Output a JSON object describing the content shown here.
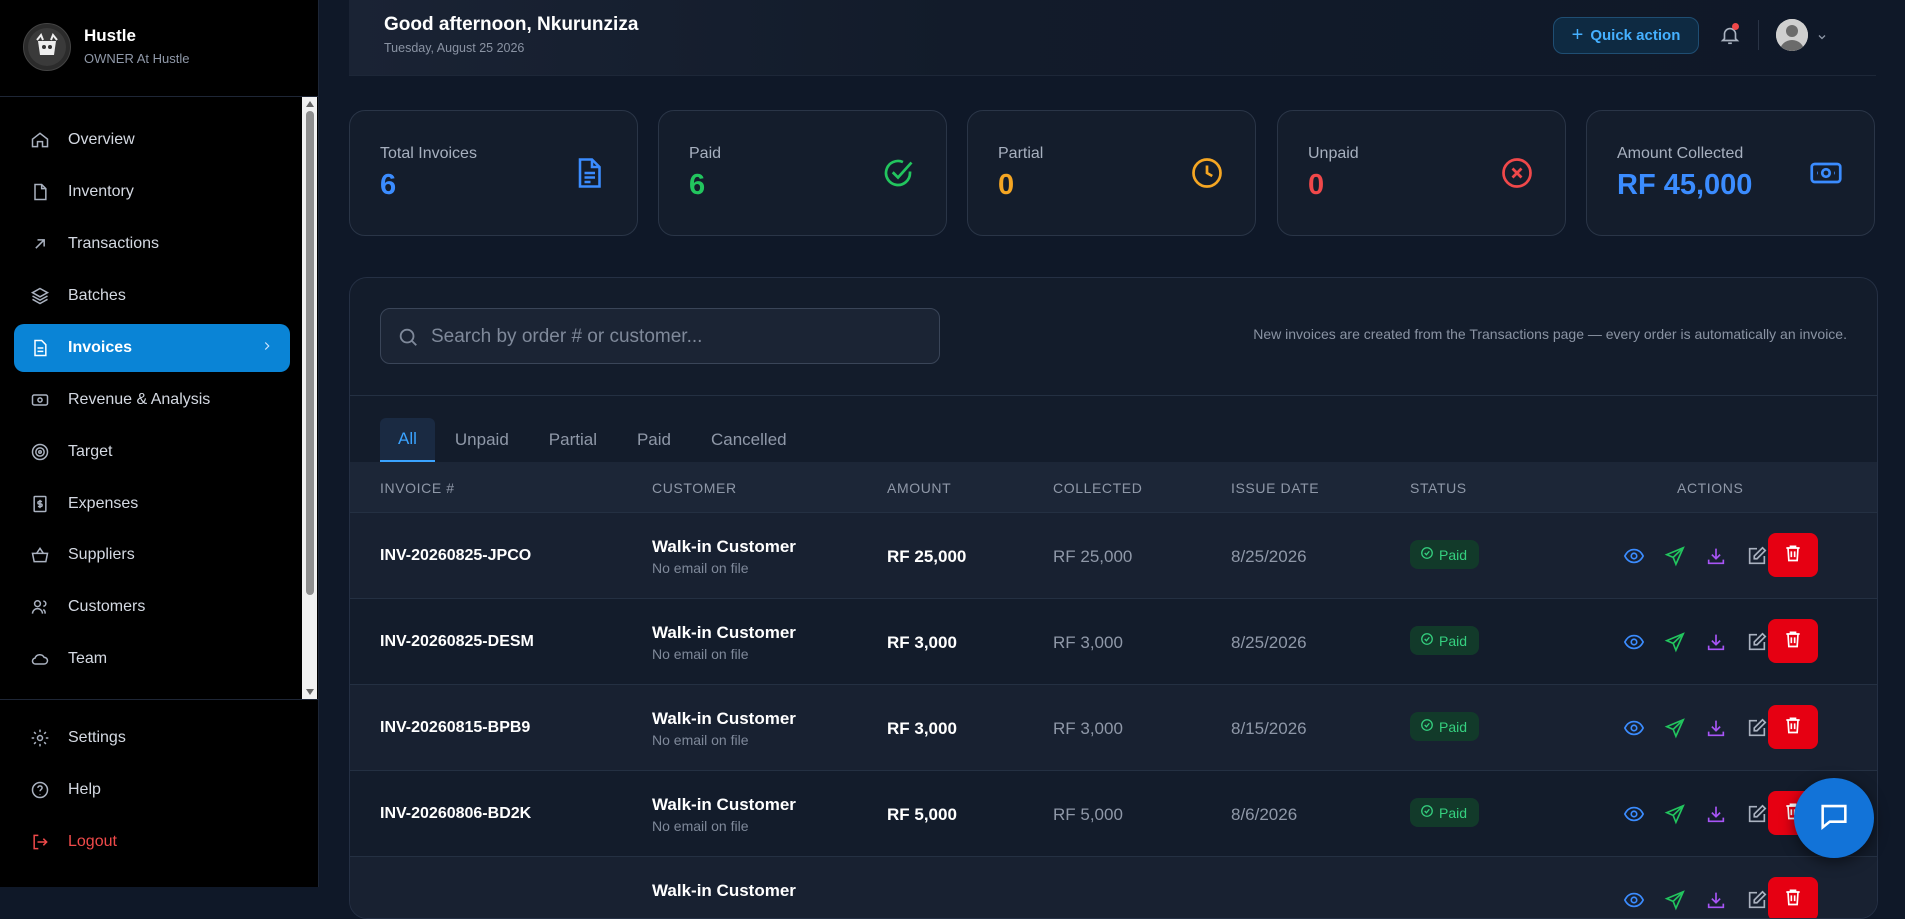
{
  "brand": {
    "name": "Hustle",
    "role": "OWNER At Hustle",
    "logo_text": "HUSTLE"
  },
  "nav": [
    {
      "label": "Overview",
      "icon": "home-icon"
    },
    {
      "label": "Inventory",
      "icon": "document-icon"
    },
    {
      "label": "Transactions",
      "icon": "arrow-up-right-icon"
    },
    {
      "label": "Batches",
      "icon": "layers-icon"
    },
    {
      "label": "Invoices",
      "icon": "invoice-icon",
      "active": true
    },
    {
      "label": "Revenue & Analysis",
      "icon": "money-icon"
    },
    {
      "label": "Target",
      "icon": "target-icon"
    },
    {
      "label": "Expenses",
      "icon": "receipt-icon"
    },
    {
      "label": "Suppliers",
      "icon": "basket-icon"
    },
    {
      "label": "Customers",
      "icon": "users-icon"
    },
    {
      "label": "Team",
      "icon": "cloud-icon"
    }
  ],
  "nav_bottom": [
    {
      "label": "Settings",
      "icon": "gear-icon"
    },
    {
      "label": "Help",
      "icon": "help-icon"
    },
    {
      "label": "Logout",
      "icon": "logout-icon"
    }
  ],
  "header": {
    "greeting": "Good afternoon, Nkurunziza",
    "date": "Tuesday, August 25 2026",
    "quick_action": "Quick action"
  },
  "stats": [
    {
      "label": "Total Invoices",
      "value": "6",
      "color": "#3b8cff",
      "icon": "document-icon"
    },
    {
      "label": "Paid",
      "value": "6",
      "color": "#22c55e",
      "icon": "check-circle-icon"
    },
    {
      "label": "Partial",
      "value": "0",
      "color": "#f5a623",
      "icon": "clock-icon"
    },
    {
      "label": "Unpaid",
      "value": "0",
      "color": "#f0484a",
      "icon": "x-circle-icon"
    },
    {
      "label": "Amount Collected",
      "value": "RF 45,000",
      "color": "#3b8cff",
      "icon": "banknote-icon"
    }
  ],
  "search": {
    "placeholder": "Search by order # or customer..."
  },
  "note": "New invoices are created from the Transactions page — every order is automatically an invoice.",
  "tabs": [
    "All",
    "Unpaid",
    "Partial",
    "Paid",
    "Cancelled"
  ],
  "table": {
    "columns": [
      "INVOICE #",
      "CUSTOMER",
      "AMOUNT",
      "COLLECTED",
      "ISSUE DATE",
      "STATUS",
      "ACTIONS"
    ],
    "rows": [
      {
        "invoice": "INV-20260825-JPCO",
        "customer": "Walk-in Customer",
        "email": "No email on file",
        "amount": "RF 25,000",
        "collected": "RF 25,000",
        "date": "8/25/2026",
        "status": "Paid"
      },
      {
        "invoice": "INV-20260825-DESM",
        "customer": "Walk-in Customer",
        "email": "No email on file",
        "amount": "RF 3,000",
        "collected": "RF 3,000",
        "date": "8/25/2026",
        "status": "Paid"
      },
      {
        "invoice": "INV-20260815-BPB9",
        "customer": "Walk-in Customer",
        "email": "No email on file",
        "amount": "RF 3,000",
        "collected": "RF 3,000",
        "date": "8/15/2026",
        "status": "Paid"
      },
      {
        "invoice": "INV-20260806-BD2K",
        "customer": "Walk-in Customer",
        "email": "No email on file",
        "amount": "RF 5,000",
        "collected": "RF 5,000",
        "date": "8/6/2026",
        "status": "Paid"
      },
      {
        "invoice": "",
        "customer": "Walk-in Customer",
        "email": "",
        "amount": "",
        "collected": "",
        "date": "",
        "status": ""
      }
    ]
  },
  "colors": {
    "accent": "#0a84d6",
    "paid": "#35d07f",
    "delete": "#e60012",
    "view": "#3b8cff",
    "send": "#22c55e",
    "download": "#a855f7"
  }
}
